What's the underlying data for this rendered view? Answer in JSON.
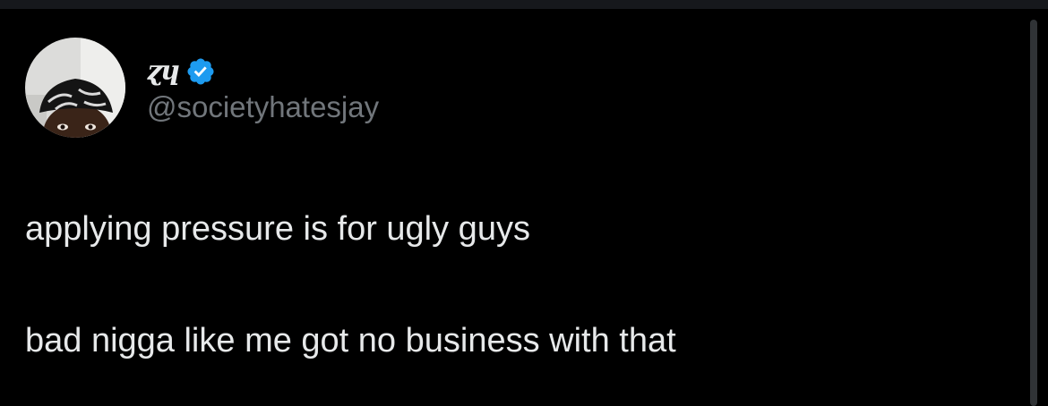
{
  "tweet": {
    "display_name": "ɀɥ",
    "verified": true,
    "handle": "@societyhatesjay",
    "lines": [
      "applying pressure is for ugly guys",
      "bad nigga like me got no business with that"
    ]
  },
  "icons": {
    "verified": "verified-badge-icon",
    "avatar": "profile-photo"
  },
  "colors": {
    "background": "#000000",
    "text": "#e7e9ea",
    "handle": "#71767b",
    "verified": "#1d9bf0"
  }
}
